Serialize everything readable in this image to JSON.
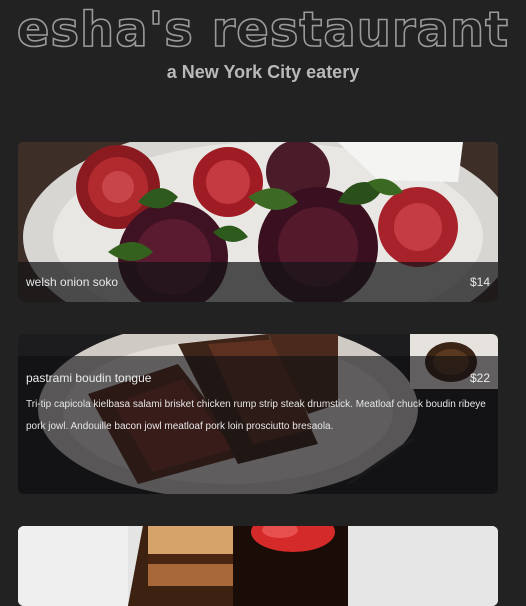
{
  "header": {
    "title": "esha's restaurant",
    "tagline": "a New York City eatery"
  },
  "menu": {
    "items": [
      {
        "name": "welsh onion soko",
        "price": "$14",
        "image": "roasted-beets-dish"
      },
      {
        "name": "pastrami boudin tongue",
        "price": "$22",
        "description": "Tri-tip capicola kielbasa salami brisket chicken rump strip steak drumstick. Meatloaf chuck boudin ribeye pork jowl. Andouille bacon jowl meatloaf pork loin prosciutto bresaola.",
        "image": "sliced-steak-dish"
      },
      {
        "image": "chocolate-cake-dessert"
      }
    ]
  }
}
